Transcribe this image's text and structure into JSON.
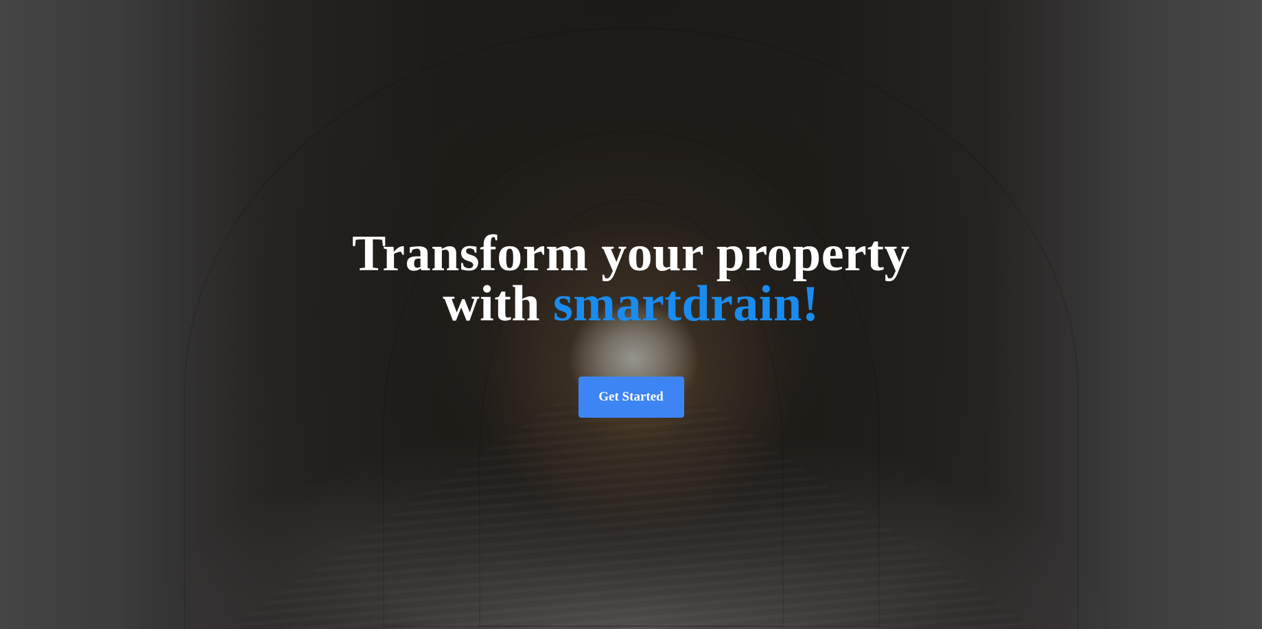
{
  "hero": {
    "headline_line1": "Transform your property",
    "headline_line2_prefix": "with ",
    "headline_brand": "smartdrain!",
    "cta_label": "Get Started"
  },
  "colors": {
    "brand_accent": "#1a8cf0",
    "button_bg": "#3d85f5",
    "text": "#ffffff"
  }
}
